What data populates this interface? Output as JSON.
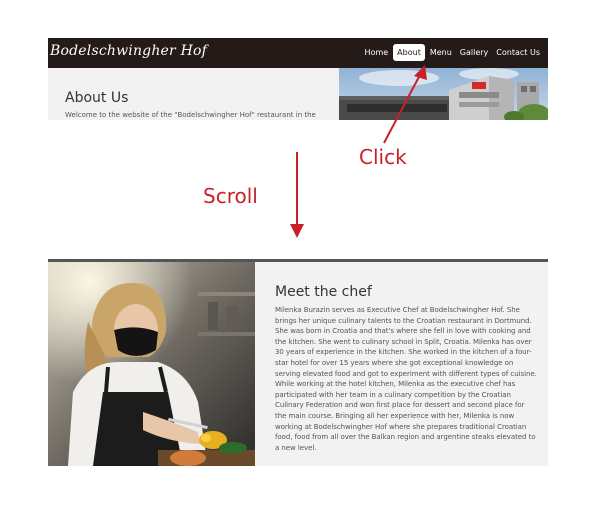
{
  "site": {
    "brand": "Bodelschwingher Hof"
  },
  "nav": {
    "items": [
      {
        "label": "Home",
        "active": false
      },
      {
        "label": "About",
        "active": true
      },
      {
        "label": "Menu",
        "active": false
      },
      {
        "label": "Gallery",
        "active": false
      },
      {
        "label": "Contact Us",
        "active": false
      }
    ]
  },
  "about": {
    "title": "About Us",
    "intro": "Welcome to the website of the \"Bodelschwingher Hof\" restaurant in the"
  },
  "annotations": {
    "click_label": "Click",
    "scroll_label": "Scroll",
    "color": "#c9202a"
  },
  "chef": {
    "title": "Meet the chef",
    "bio": "Milenka Burazin serves as Executive Chef at Bodelschwingher Hof. She brings her unique culinary talents to the Croatian restaurant in Dortmund. She was born in Croatia and that's where she fell in love with cooking and the kitchen. She went to culinary school in Split, Croatia. Milenka has over 30 years of experience in the kitchen. She worked in the kitchen of a four-star hotel for over 15 years where she got exceptional knowledge on serving elevated food and got to experiment with different types of cuisine. While working at the hotel kitchen, Milenka as the executive chef has participated with her team in a culinary competition by the Croatian Culinary Federation and won first place for dessert and second place for the main course. Bringing all her experience with her, Milenka is now working at Bodelschwingher Hof where she prepares traditional Croatian food, food from all over the Balkan region and argentine steaks elevated to a new level."
  },
  "colors": {
    "navbar": "#241a17",
    "section_bg": "#f2f2f2",
    "accent_red": "#c9202a"
  }
}
